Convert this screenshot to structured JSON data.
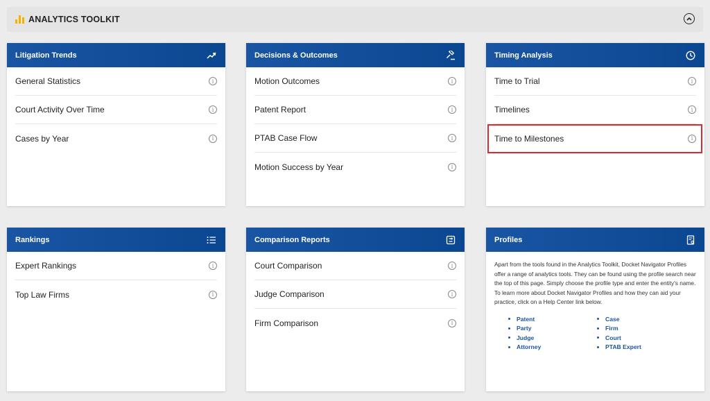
{
  "header": {
    "title": "ANALYTICS TOOLKIT"
  },
  "cards": {
    "litigation": {
      "title": "Litigation Trends",
      "items": [
        {
          "label": "General Statistics"
        },
        {
          "label": "Court Activity Over Time"
        },
        {
          "label": "Cases by Year"
        }
      ]
    },
    "decisions": {
      "title": "Decisions & Outcomes",
      "items": [
        {
          "label": "Motion Outcomes"
        },
        {
          "label": "Patent Report"
        },
        {
          "label": "PTAB Case Flow"
        },
        {
          "label": "Motion Success by Year"
        }
      ]
    },
    "timing": {
      "title": "Timing Analysis",
      "items": [
        {
          "label": "Time to Trial"
        },
        {
          "label": "Timelines"
        },
        {
          "label": "Time to Milestones"
        }
      ]
    },
    "rankings": {
      "title": "Rankings",
      "items": [
        {
          "label": "Expert Rankings"
        },
        {
          "label": "Top Law Firms"
        }
      ]
    },
    "comparison": {
      "title": "Comparison Reports",
      "items": [
        {
          "label": "Court Comparison"
        },
        {
          "label": "Judge Comparison"
        },
        {
          "label": "Firm Comparison"
        }
      ]
    },
    "profiles": {
      "title": "Profiles",
      "description": "Apart from the tools found in the Analytics Toolkit, Docket Navigator Profiles offer a range of analytics tools. They can be found using the profile search near the top of this page. Simply choose the profile type and enter the entity's name. To learn more about Docket Navigator Profiles and how they can aid your practice, click on a Help Center link below.",
      "links": [
        "Patent",
        "Case",
        "Party",
        "Firm",
        "Judge",
        "Court",
        "Attorney",
        "PTAB Expert"
      ]
    }
  },
  "info_glyph": "i",
  "colors": {
    "header_blue": "#0b4791",
    "accent_yellow": "#f0b400",
    "highlight_red": "#e0262f",
    "link_blue": "#1a55a4"
  }
}
